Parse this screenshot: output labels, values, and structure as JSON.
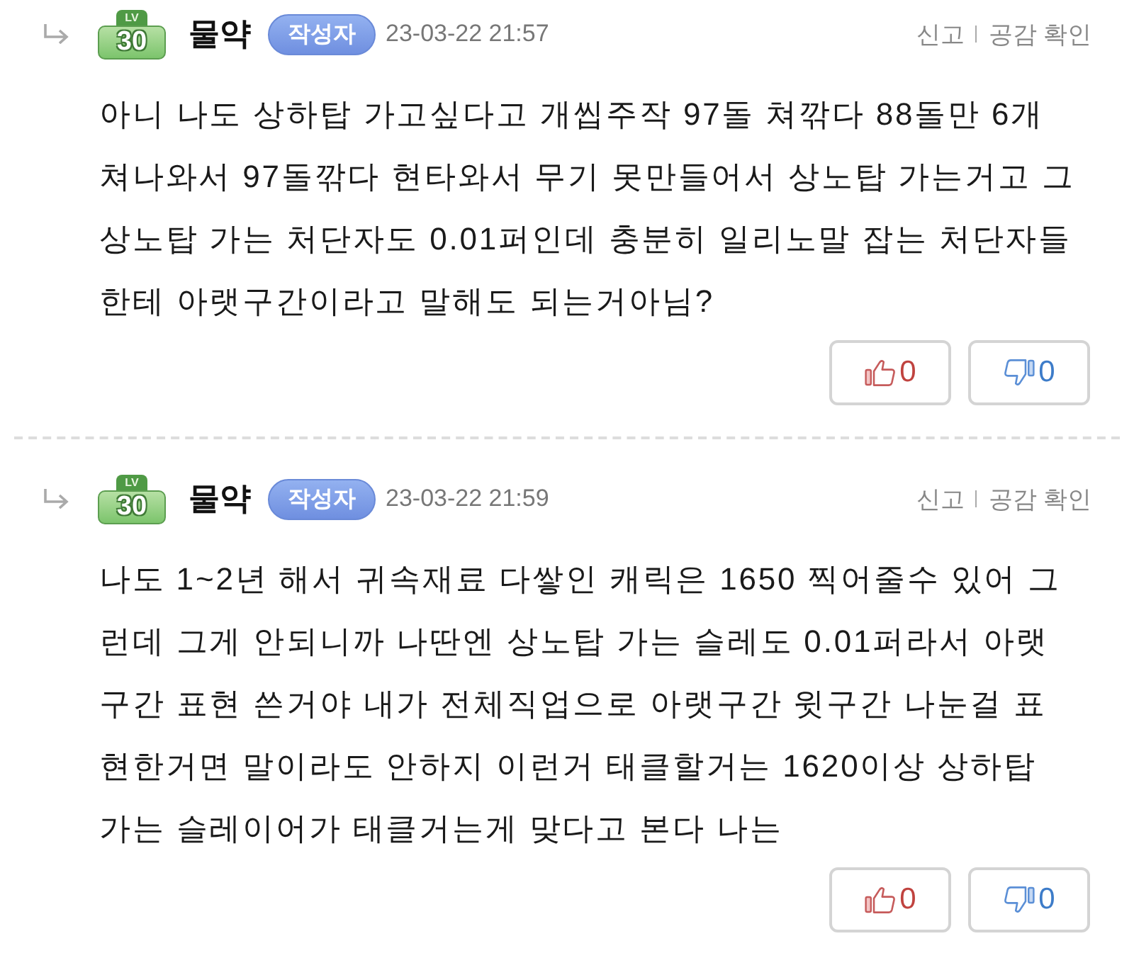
{
  "comments": [
    {
      "is_reply": true,
      "level_label": "LV",
      "level": "30",
      "author": "물약",
      "author_badge": "작성자",
      "date": "23-03-22 21:57",
      "actions": [
        "신고",
        "공감 확인"
      ],
      "body": "아니 나도 상하탑 가고싶다고 개씹주작 97돌 쳐깎다 88돌만 6개 쳐나와서 97돌깎다 현타와서 무기 못만들어서 상노탑 가는거고 그 상노탑 가는 처단자도 0.01퍼인데 충분히 일리노말 잡는 처단자들한테 아랫구간이라고 말해도 되는거아님?",
      "likes": "0",
      "dislikes": "0"
    },
    {
      "is_reply": true,
      "level_label": "LV",
      "level": "30",
      "author": "물약",
      "author_badge": "작성자",
      "date": "23-03-22 21:59",
      "actions": [
        "신고",
        "공감 확인"
      ],
      "body": "나도 1~2년 해서 귀속재료 다쌓인 캐릭은 1650 찍어줄수 있어 그런데 그게 안되니까 나딴엔 상노탑 가는 슬레도 0.01퍼라서 아랫구간 표현 쓴거야 내가 전체직업으로 아랫구간 윗구간 나눈걸 표현한거면 말이라도 안하지 이런거 태클할거는 1620이상 상하탑 가는 슬레이어가 태클거는게 맞다고 본다 나는",
      "likes": "0",
      "dislikes": "0"
    }
  ]
}
